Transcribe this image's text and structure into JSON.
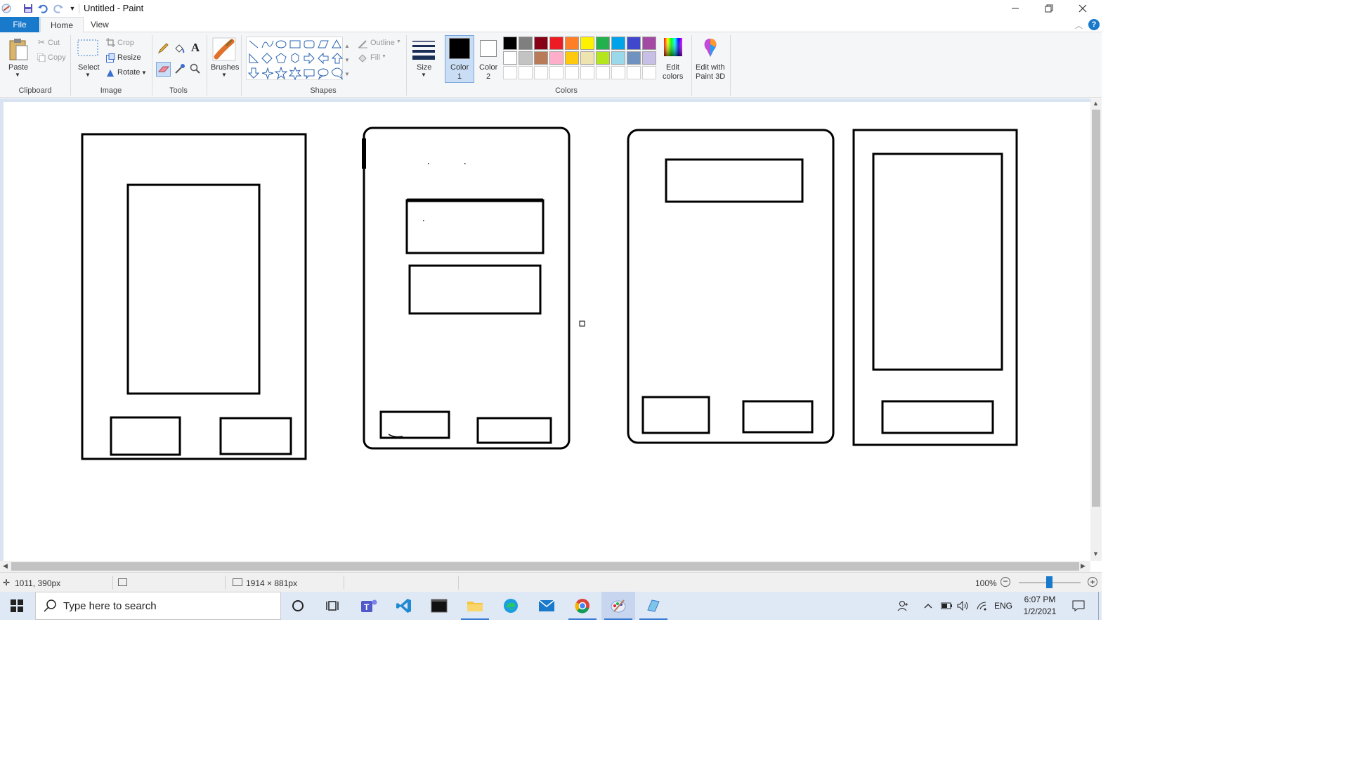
{
  "window": {
    "title": "Untitled - Paint",
    "qat": [
      "save-icon",
      "undo-icon",
      "redo-icon",
      "customize-icon"
    ],
    "controls": [
      "minimize",
      "maximize",
      "close"
    ]
  },
  "tabs": [
    {
      "label": "File"
    },
    {
      "label": "Home"
    },
    {
      "label": "View"
    }
  ],
  "ribbon": {
    "clipboard": {
      "paste": "Paste",
      "cut": "Cut",
      "copy": "Copy",
      "group": "Clipboard"
    },
    "image": {
      "select": "Select",
      "crop": "Crop",
      "resize": "Resize",
      "rotate": "Rotate",
      "group": "Image"
    },
    "tools": {
      "group": "Tools"
    },
    "brushes": {
      "label": "Brushes"
    },
    "shapes": {
      "outline": "Outline",
      "fill": "Fill",
      "group": "Shapes"
    },
    "size": {
      "label": "Size"
    },
    "colors": {
      "color1": "Color\n1",
      "color1_l1": "Color",
      "color1_l2": "1",
      "color2_l1": "Color",
      "color2_l2": "2",
      "edit_l1": "Edit",
      "edit_l2": "colors",
      "paint3d_l1": "Edit with",
      "paint3d_l2": "Paint 3D",
      "group": "Colors",
      "row1": [
        "#000000",
        "#7f7f7f",
        "#880015",
        "#ed1c24",
        "#ff7f27",
        "#fff200",
        "#22b14c",
        "#00a2e8",
        "#3f48cc",
        "#a349a4"
      ],
      "row2": [
        "#ffffff",
        "#c3c3c3",
        "#b97a57",
        "#ffaec9",
        "#ffc90e",
        "#efe4b0",
        "#b5e61d",
        "#99d9ea",
        "#7092be",
        "#c8bfe7"
      ]
    }
  },
  "status": {
    "cursor_pos": "1011, 390px",
    "canvas_size": "1914 × 881px",
    "zoom": "100%"
  },
  "taskbar": {
    "search_placeholder": "Type here to search",
    "lang": "ENG",
    "time": "6:07 PM",
    "date": "1/2/2021"
  }
}
